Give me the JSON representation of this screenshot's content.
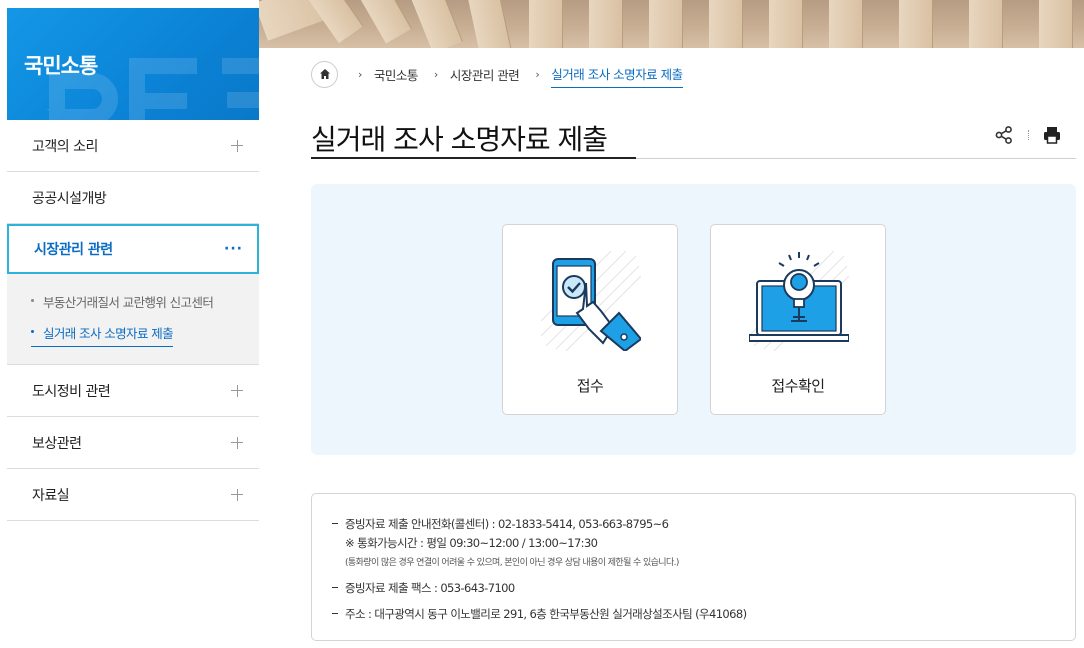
{
  "sidebar": {
    "title": "국민소통",
    "items": [
      {
        "label": "고객의 소리"
      },
      {
        "label": "공공시설개방"
      },
      {
        "label": "시장관리 관련"
      },
      {
        "label": "도시정비 관련"
      },
      {
        "label": "보상관련"
      },
      {
        "label": "자료실"
      }
    ],
    "active_more": "···",
    "submenu": [
      {
        "label": "부동산거래질서 교란행위 신고센터"
      },
      {
        "label": "실거래 조사 소명자료 제출"
      }
    ]
  },
  "breadcrumb": {
    "items": [
      "국민소통",
      "시장관리 관련",
      "실거래 조사 소명자료 제출"
    ],
    "separator": "›"
  },
  "page": {
    "title": "실거래 조사 소명자료 제출"
  },
  "cards": [
    {
      "label": "접수",
      "icon": "phone-touch-icon"
    },
    {
      "label": "접수확인",
      "icon": "laptop-bulb-icon"
    }
  ],
  "info": {
    "phone": "증빙자료 제출 안내전화(콜센터) : 02-1833-5414, 053-663-8795~6",
    "hours": "※ 통화가능시간 : 평일 09:30~12:00 / 13:00~17:30",
    "hours_note": "(통화량이 많은 경우 연결이 어려울 수 있으며, 본인이 아닌 경우 상담 내용이 제한될 수 있습니다.)",
    "fax": "증빙자료 제출 팩스 : 053-643-7100",
    "address": "주소 : 대구광역시 동구 이노밸리로 291, 6층 한국부동산원 실거래상설조사팀 (우41068)"
  },
  "colors": {
    "brand_blue": "#0b83d6",
    "active_text": "#0b6cc2",
    "active_border": "#2bb3dc",
    "card_bg": "#eef6fd"
  }
}
